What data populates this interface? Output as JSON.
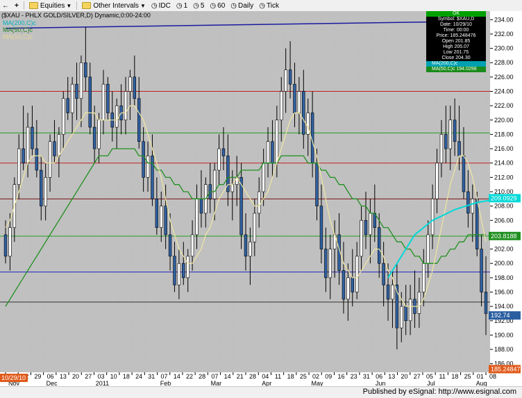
{
  "toolbar": {
    "items": [
      {
        "name": "back-icon",
        "label": "←"
      },
      {
        "name": "new-icon",
        "label": "+"
      },
      {
        "name": "equities",
        "label": "Equities"
      },
      {
        "name": "other-intervals",
        "label": "Other Intervals"
      },
      {
        "name": "idc",
        "label": "IDC"
      },
      {
        "name": "interval-1",
        "label": "1"
      },
      {
        "name": "interval-5",
        "label": "5"
      },
      {
        "name": "interval-60",
        "label": "60"
      },
      {
        "name": "daily",
        "label": "Daily"
      },
      {
        "name": "tick",
        "label": "Tick"
      }
    ]
  },
  "chart": {
    "title": "($XAU - PHLX GOLD/SILVER,D) Dynamic,0:00-24:00",
    "legend": {
      "ma200": "MA(200,C)c",
      "ma50": "MA(50,C)c",
      "ma10": "MA(10,C)c"
    },
    "data_window": {
      "header": "OK",
      "symbol": "Symbol: $XAU,D",
      "date": "Date: 10/29/10",
      "time": "Time: 00:00",
      "price": "Price: 185.248476",
      "open": "Open 201.85",
      "high": "High 205.07",
      "low": "Low 201.75",
      "close": "Close 204.30",
      "ma200": "MA(200,C)c",
      "ma50": "MA(50,C)c 194.0298"
    },
    "price_labels": [
      "234.00",
      "232.00",
      "230.00",
      "228.00",
      "226.00",
      "224.00",
      "222.00",
      "220.00",
      "218.00",
      "216.00",
      "214.00",
      "212.00",
      "210.00",
      "208.00",
      "206.00",
      "204.00",
      "202.00",
      "200.00",
      "198.00",
      "196.00",
      "194.00",
      "192.00",
      "190.00",
      "188.00",
      "186.00"
    ],
    "markers": {
      "ma200_value": "209.0929",
      "ma50_value": "203.8188",
      "last_price": "192.74",
      "crosshair_price": "185.248476",
      "crosshair_date": "10/29/10"
    },
    "date_ticks": [
      "15",
      "22",
      "29",
      "06",
      "13",
      "20",
      "27",
      "03",
      "10",
      "18",
      "24",
      "31",
      "07",
      "14",
      "22",
      "28",
      "07",
      "14",
      "21",
      "28",
      "04",
      "11",
      "18",
      "25",
      "02",
      "09",
      "16",
      "23",
      "31",
      "06",
      "13",
      "20",
      "27",
      "05",
      "11",
      "18",
      "25",
      "01",
      "08"
    ],
    "month_labels": [
      {
        "label": "Nov",
        "idx": 0
      },
      {
        "label": "Dec",
        "idx": 3
      },
      {
        "label": "2011",
        "idx": 7
      },
      {
        "label": "Feb",
        "idx": 12
      },
      {
        "label": "Mar",
        "idx": 16
      },
      {
        "label": "Apr",
        "idx": 20
      },
      {
        "label": "May",
        "idx": 24
      },
      {
        "label": "Jun",
        "idx": 29
      },
      {
        "label": "Jul",
        "idx": 33
      },
      {
        "label": "Aug",
        "idx": 37
      }
    ],
    "colors": {
      "background": "#c0c0c0",
      "up": "#ffffff",
      "down": "#3060a0",
      "ma10": "#f0e6a0",
      "ma50": "#1f8f1f",
      "ma200": "#00d8d8",
      "red_line": "#c02020",
      "blue_line": "#2020c0",
      "green_line": "#20a020"
    }
  },
  "status": {
    "published": "Published by eSignal: http://www.esignal.com"
  },
  "chart_data": {
    "type": "candlestick",
    "ylim": [
      185,
      235
    ],
    "horizontal_lines": [
      {
        "y": 224,
        "color": "red"
      },
      {
        "y": 218.2,
        "color": "green"
      },
      {
        "y": 214,
        "color": "red"
      },
      {
        "y": 209,
        "color": "darkred"
      },
      {
        "y": 203.8,
        "color": "green"
      },
      {
        "y": 198.8,
        "color": "blue"
      },
      {
        "y": 194.6,
        "color": "dark"
      }
    ],
    "trendline": [
      [
        0,
        232.8
      ],
      [
        118,
        233.8
      ]
    ],
    "candles": [
      [
        204,
        206,
        200,
        201
      ],
      [
        201,
        207,
        199,
        205
      ],
      [
        205,
        212,
        203,
        211
      ],
      [
        211,
        218,
        209,
        216
      ],
      [
        216,
        222,
        213,
        214
      ],
      [
        214,
        221,
        212,
        219
      ],
      [
        219,
        222,
        215,
        216
      ],
      [
        216,
        220,
        212,
        213
      ],
      [
        213,
        215,
        206,
        208
      ],
      [
        208,
        214,
        206,
        212
      ],
      [
        212,
        218,
        210,
        217
      ],
      [
        217,
        220,
        214,
        215
      ],
      [
        215,
        219,
        212,
        218
      ],
      [
        218,
        224,
        216,
        223
      ],
      [
        223,
        226,
        220,
        221
      ],
      [
        221,
        226,
        218,
        225
      ],
      [
        225,
        228,
        220,
        223
      ],
      [
        223,
        229,
        219,
        228
      ],
      [
        228,
        233,
        224,
        226
      ],
      [
        226,
        228,
        218,
        219
      ],
      [
        219,
        222,
        214,
        216
      ],
      [
        216,
        221,
        214,
        220
      ],
      [
        220,
        227,
        218,
        225
      ],
      [
        225,
        226,
        220,
        221
      ],
      [
        221,
        224,
        217,
        219
      ],
      [
        219,
        223,
        216,
        222
      ],
      [
        222,
        225,
        218,
        220
      ],
      [
        220,
        226,
        218,
        224
      ],
      [
        224,
        227,
        220,
        226
      ],
      [
        226,
        229,
        222,
        223
      ],
      [
        223,
        226,
        216,
        217
      ],
      [
        217,
        219,
        210,
        212
      ],
      [
        212,
        217,
        210,
        215
      ],
      [
        215,
        218,
        208,
        209
      ],
      [
        209,
        212,
        204,
        205
      ],
      [
        205,
        210,
        203,
        208
      ],
      [
        208,
        211,
        202,
        204
      ],
      [
        204,
        207,
        199,
        201
      ],
      [
        201,
        203,
        196,
        197
      ],
      [
        197,
        202,
        195,
        200
      ],
      [
        200,
        203,
        197,
        198
      ],
      [
        198,
        202,
        196,
        201
      ],
      [
        201,
        206,
        199,
        204
      ],
      [
        204,
        211,
        202,
        209
      ],
      [
        209,
        213,
        205,
        207
      ],
      [
        207,
        212,
        205,
        211
      ],
      [
        211,
        214,
        207,
        209
      ],
      [
        209,
        214,
        206,
        213
      ],
      [
        213,
        218,
        211,
        216
      ],
      [
        216,
        219,
        213,
        215
      ],
      [
        215,
        218,
        208,
        210
      ],
      [
        210,
        213,
        206,
        211
      ],
      [
        211,
        215,
        208,
        212
      ],
      [
        212,
        214,
        202,
        204
      ],
      [
        204,
        207,
        199,
        201
      ],
      [
        201,
        205,
        197,
        203
      ],
      [
        203,
        209,
        201,
        207
      ],
      [
        207,
        212,
        205,
        210
      ],
      [
        210,
        216,
        208,
        214
      ],
      [
        214,
        219,
        212,
        217
      ],
      [
        217,
        220,
        212,
        214
      ],
      [
        214,
        222,
        212,
        220
      ],
      [
        220,
        226,
        217,
        224
      ],
      [
        224,
        230,
        221,
        227
      ],
      [
        227,
        231,
        223,
        225
      ],
      [
        225,
        228,
        219,
        221
      ],
      [
        221,
        226,
        218,
        224
      ],
      [
        224,
        227,
        216,
        218
      ],
      [
        218,
        223,
        215,
        221
      ],
      [
        221,
        224,
        212,
        214
      ],
      [
        214,
        216,
        206,
        208
      ],
      [
        208,
        211,
        200,
        202
      ],
      [
        202,
        205,
        196,
        198
      ],
      [
        198,
        204,
        195,
        202
      ],
      [
        202,
        206,
        198,
        204
      ],
      [
        204,
        207,
        197,
        199
      ],
      [
        199,
        203,
        193,
        195
      ],
      [
        195,
        200,
        192,
        198
      ],
      [
        198,
        202,
        194,
        196
      ],
      [
        196,
        203,
        195,
        201
      ],
      [
        201,
        208,
        199,
        206
      ],
      [
        206,
        210,
        202,
        204
      ],
      [
        204,
        209,
        200,
        207
      ],
      [
        207,
        211,
        203,
        205
      ],
      [
        205,
        207,
        198,
        200
      ],
      [
        200,
        203,
        194,
        197
      ],
      [
        197,
        200,
        192,
        195
      ],
      [
        195,
        199,
        191,
        197
      ],
      [
        197,
        200,
        188,
        191
      ],
      [
        191,
        196,
        189,
        194
      ],
      [
        194,
        197,
        190,
        192
      ],
      [
        192,
        197,
        190,
        195
      ],
      [
        195,
        199,
        191,
        193
      ],
      [
        193,
        198,
        191,
        196
      ],
      [
        196,
        202,
        194,
        200
      ],
      [
        200,
        206,
        198,
        204
      ],
      [
        204,
        211,
        202,
        209
      ],
      [
        209,
        216,
        207,
        214
      ],
      [
        214,
        220,
        212,
        218
      ],
      [
        218,
        222,
        214,
        216
      ],
      [
        216,
        222,
        213,
        220
      ],
      [
        220,
        223,
        215,
        217
      ],
      [
        217,
        222,
        213,
        215
      ],
      [
        215,
        219,
        209,
        210
      ],
      [
        210,
        213,
        205,
        207
      ],
      [
        207,
        211,
        203,
        209
      ],
      [
        209,
        210,
        201,
        202
      ],
      [
        202,
        204,
        194,
        196
      ],
      [
        196,
        201,
        190,
        193
      ]
    ],
    "ma10": [
      205,
      206,
      208,
      210,
      212,
      214,
      215,
      215,
      215,
      214,
      214,
      214,
      215,
      216,
      217,
      218,
      219,
      220,
      221,
      221,
      221,
      220,
      220,
      220,
      220,
      220,
      221,
      221,
      222,
      222,
      221,
      220,
      218,
      216,
      214,
      212,
      209,
      206,
      204,
      202,
      201,
      200,
      200,
      201,
      202,
      204,
      205,
      207,
      209,
      210,
      211,
      211,
      212,
      211,
      210,
      209,
      208,
      208,
      209,
      210,
      212,
      214,
      216,
      218,
      220,
      221,
      221,
      220,
      219,
      217,
      215,
      212,
      209,
      206,
      204,
      202,
      200,
      199,
      198,
      198,
      199,
      200,
      201,
      202,
      202,
      201,
      199,
      198,
      196,
      195,
      194,
      194,
      194,
      194,
      195,
      197,
      199,
      202,
      205,
      208,
      211,
      213,
      215,
      215,
      214,
      212,
      209,
      206,
      203
    ],
    "ma50": [
      194,
      195,
      196,
      197,
      198,
      199,
      200,
      201,
      202,
      203,
      204,
      205,
      206,
      207,
      208,
      209,
      210,
      211,
      212,
      213,
      214,
      215,
      215,
      215,
      216,
      216,
      216,
      216,
      216,
      216,
      215,
      215,
      214,
      214,
      213,
      213,
      212,
      212,
      211,
      211,
      210,
      210,
      209,
      209,
      209,
      209,
      210,
      210,
      211,
      211,
      212,
      212,
      212,
      213,
      213,
      213,
      213,
      213,
      214,
      214,
      214,
      214,
      215,
      215,
      215,
      215,
      215,
      215,
      214,
      214,
      214,
      213,
      213,
      212,
      212,
      211,
      211,
      210,
      209,
      209,
      208,
      208,
      207,
      207,
      206,
      205,
      205,
      204,
      203,
      203,
      202,
      202,
      201,
      201,
      200,
      200,
      200,
      200,
      201,
      201,
      202,
      202,
      203,
      203,
      204,
      204,
      204,
      204,
      204
    ],
    "ma200_start_index": 36,
    "ma200": [
      198,
      199,
      200,
      201,
      202,
      203,
      204,
      204.5,
      205,
      205.5,
      206,
      206.3,
      206.6,
      206.9,
      207.2,
      207.5,
      207.7,
      207.9,
      208.1,
      208.3,
      208.5,
      208.6,
      208.7,
      208.8,
      208.9,
      209,
      209.05,
      209.1
    ]
  }
}
